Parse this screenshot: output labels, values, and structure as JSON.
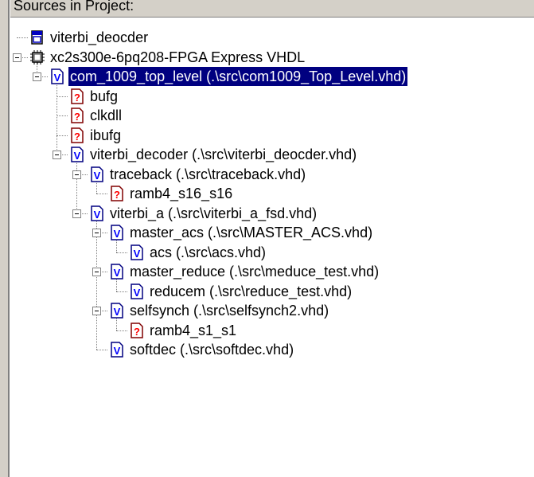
{
  "panel": {
    "title": "Sources in Project:"
  },
  "tree": [
    {
      "label": "viterbi_deocder",
      "icon": "project-icon",
      "depth": 0,
      "expandable": false
    },
    {
      "label": "xc2s300e-6pq208-FPGA Express VHDL",
      "icon": "chip-icon",
      "depth": 0,
      "expandable": true
    },
    {
      "label": "com_1009_top_level (.\\src\\com1009_Top_Level.vhd)",
      "icon": "vhdl-file-icon",
      "depth": 1,
      "expandable": true,
      "selected": true
    },
    {
      "label": "bufg",
      "icon": "missing-file-icon",
      "depth": 2,
      "expandable": false
    },
    {
      "label": "clkdll",
      "icon": "missing-file-icon",
      "depth": 2,
      "expandable": false
    },
    {
      "label": "ibufg",
      "icon": "missing-file-icon",
      "depth": 2,
      "expandable": false
    },
    {
      "label": "viterbi_decoder (.\\src\\viterbi_deocder.vhd)",
      "icon": "vhdl-file-icon",
      "depth": 2,
      "expandable": true
    },
    {
      "label": "traceback (.\\src\\traceback.vhd)",
      "icon": "vhdl-file-icon",
      "depth": 3,
      "expandable": true
    },
    {
      "label": "ramb4_s16_s16",
      "icon": "missing-file-icon",
      "depth": 4,
      "expandable": false
    },
    {
      "label": "viterbi_a (.\\src\\viterbi_a_fsd.vhd)",
      "icon": "vhdl-file-icon",
      "depth": 3,
      "expandable": true
    },
    {
      "label": "master_acs (.\\src\\MASTER_ACS.vhd)",
      "icon": "vhdl-file-icon",
      "depth": 4,
      "expandable": true
    },
    {
      "label": "acs (.\\src\\acs.vhd)",
      "icon": "vhdl-file-icon",
      "depth": 5,
      "expandable": false
    },
    {
      "label": "master_reduce (.\\src\\meduce_test.vhd)",
      "icon": "vhdl-file-icon",
      "depth": 4,
      "expandable": true
    },
    {
      "label": "reducem (.\\src\\reduce_test.vhd)",
      "icon": "vhdl-file-icon",
      "depth": 5,
      "expandable": false
    },
    {
      "label": "selfsynch (.\\src\\selfsynch2.vhd)",
      "icon": "vhdl-file-icon",
      "depth": 4,
      "expandable": true
    },
    {
      "label": "ramb4_s1_s1",
      "icon": "missing-file-icon",
      "depth": 5,
      "expandable": false
    },
    {
      "label": "softdec (.\\src\\softdec.vhd)",
      "icon": "vhdl-file-icon",
      "depth": 4,
      "expandable": false
    }
  ],
  "colors": {
    "selection": "#000080",
    "vhdl_icon": "#0000ff",
    "missing_icon": "#ff0000",
    "tree_lines": "#808080"
  }
}
